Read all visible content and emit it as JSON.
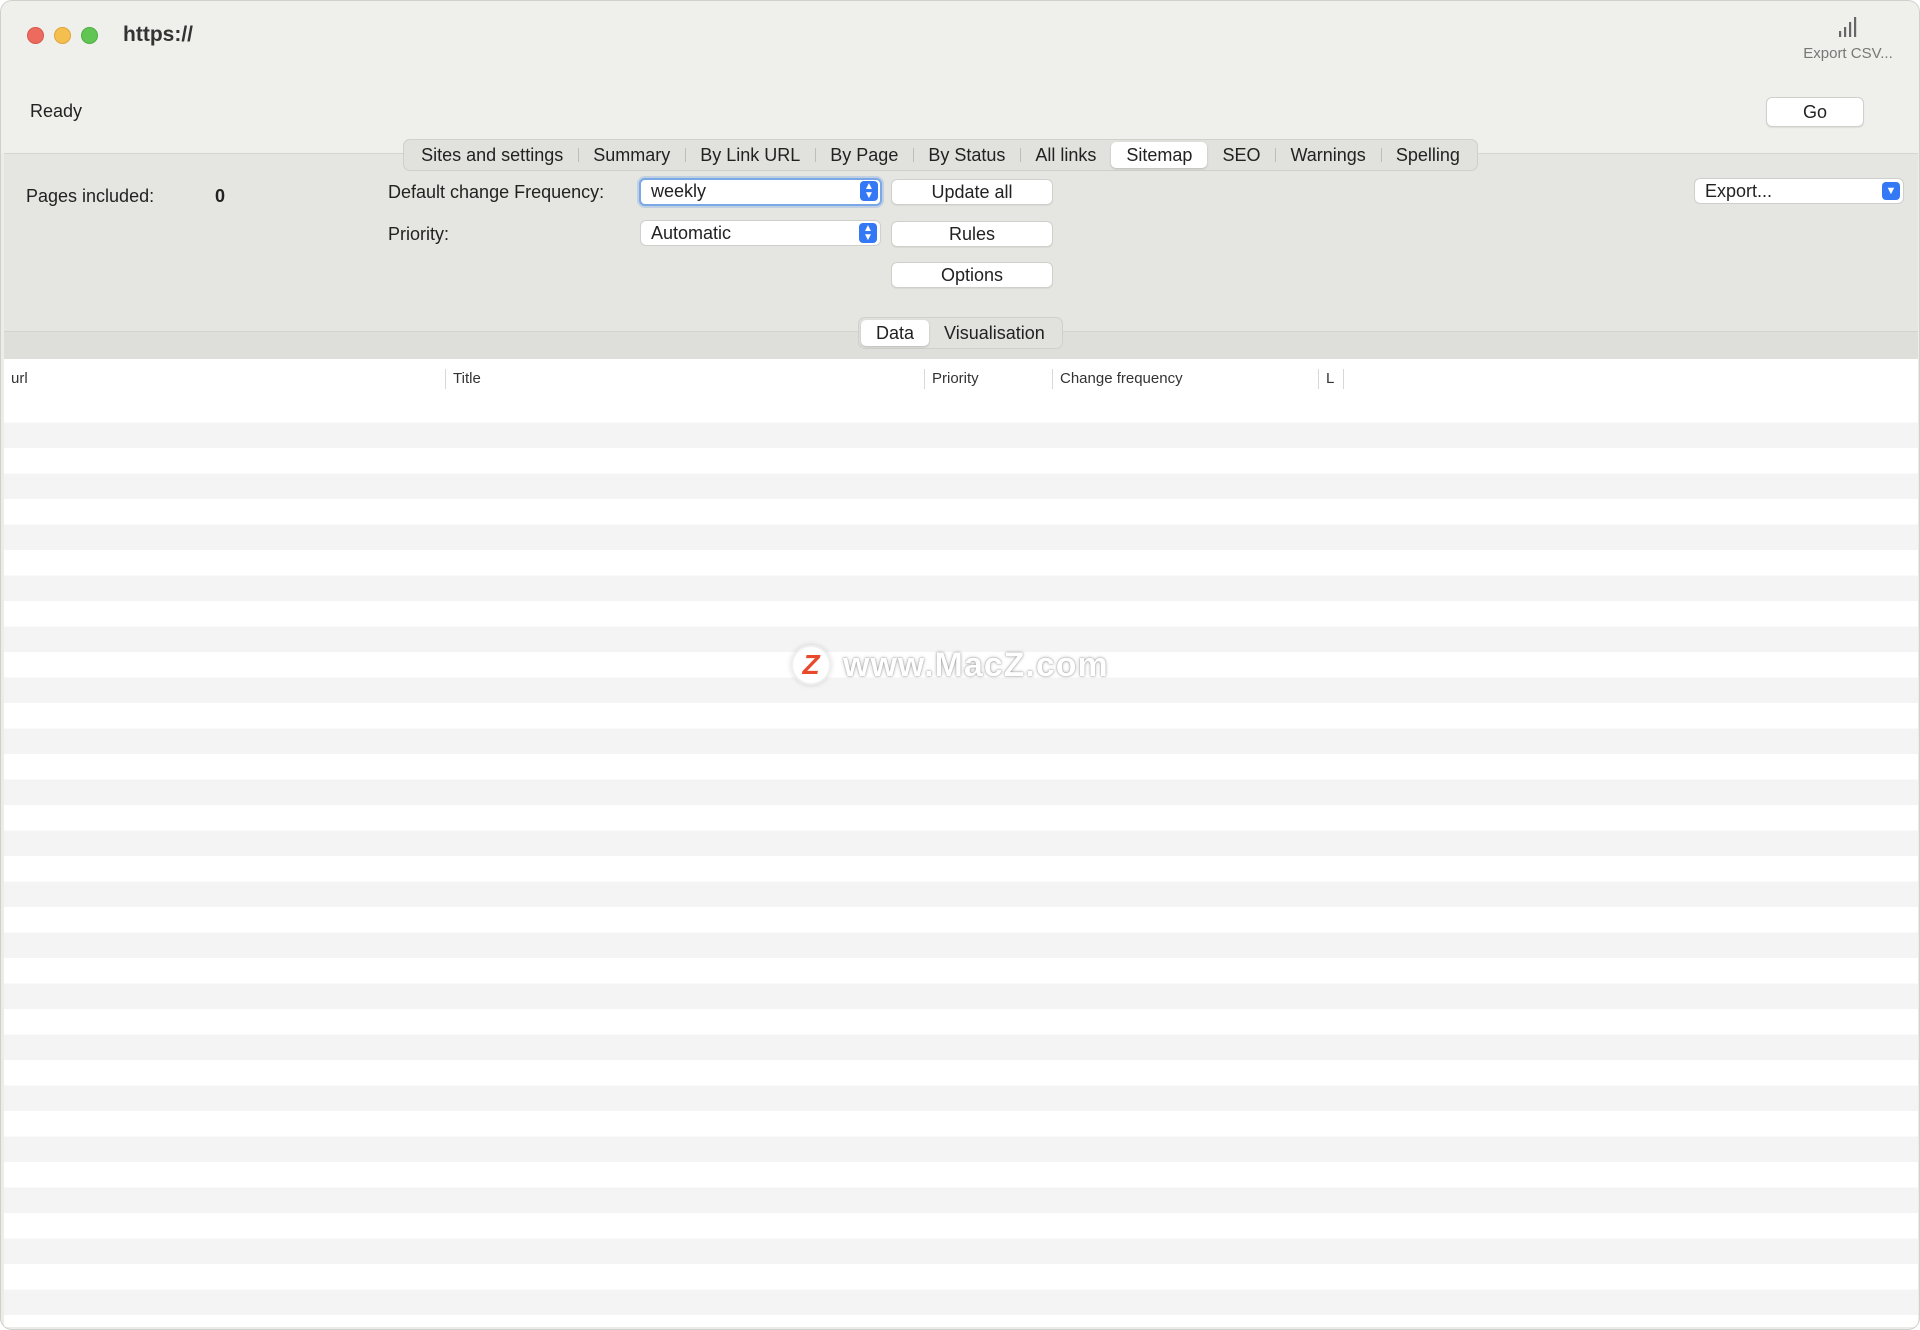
{
  "window": {
    "title": "https://",
    "export_csv_label": "Export CSV..."
  },
  "status": {
    "text": "Ready",
    "go_label": "Go"
  },
  "tabs": [
    {
      "label": "Sites and settings"
    },
    {
      "label": "Summary"
    },
    {
      "label": "By Link URL"
    },
    {
      "label": "By Page"
    },
    {
      "label": "By Status"
    },
    {
      "label": "All links"
    },
    {
      "label": "Sitemap",
      "active": true
    },
    {
      "label": "SEO"
    },
    {
      "label": "Warnings"
    },
    {
      "label": "Spelling"
    }
  ],
  "sitemap": {
    "pages_included_label": "Pages included:",
    "pages_included_value": "0",
    "default_change_frequency_label": "Default change Frequency:",
    "default_change_frequency_value": "weekly",
    "priority_label": "Priority:",
    "priority_value": "Automatic",
    "update_all_label": "Update all",
    "rules_label": "Rules",
    "options_label": "Options",
    "export_label": "Export..."
  },
  "view_toggle": {
    "data_label": "Data",
    "visualisation_label": "Visualisation"
  },
  "table": {
    "columns": [
      "url",
      "Title",
      "Priority",
      "Change frequency",
      "L"
    ],
    "rows": []
  },
  "watermark": {
    "logo_letter": "Z",
    "text": "www.MacZ.com"
  },
  "colors": {
    "accent": "#3478f6",
    "focus_ring": "#7aa7e6",
    "close": "#ed6a5e",
    "minimize": "#f5bf4f",
    "zoom": "#61c554"
  }
}
